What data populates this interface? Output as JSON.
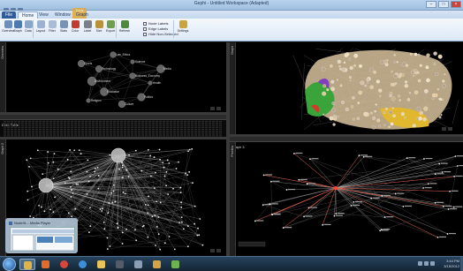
{
  "window": {
    "title": "Gephi - Untitled Workspace (Adapted)",
    "minimize_label": "–",
    "maximize_label": "□",
    "close_label": "×"
  },
  "ribbon_tabs": [
    {
      "label": "File"
    },
    {
      "label": "Home"
    },
    {
      "label": "View"
    },
    {
      "label": "Window"
    },
    {
      "label": "Graph"
    }
  ],
  "context_tab_label": "Tools",
  "ribbon": {
    "buttons": [
      {
        "label": "Overview",
        "icon": "overview-icon",
        "color": "#6a8fbf"
      },
      {
        "label": "Graph",
        "icon": "graph-icon",
        "color": "#4d79b0"
      },
      {
        "label": "Data",
        "icon": "data-icon",
        "color": "#8aa6c8"
      },
      {
        "label": "Layout",
        "icon": "layout-icon",
        "color": "#9cb2cf"
      },
      {
        "label": "Filter",
        "icon": "filter-icon",
        "color": "#a9bdd6"
      },
      {
        "label": "Stats",
        "icon": "stats-icon",
        "color": "#7993b5"
      },
      {
        "label": "Color",
        "icon": "color-icon",
        "color": "#c33a2e"
      },
      {
        "label": "Label",
        "icon": "label-icon",
        "color": "#7a7f8c"
      },
      {
        "label": "Size",
        "icon": "size-icon",
        "color": "#b8923a"
      },
      {
        "label": "Export",
        "icon": "export-icon",
        "color": "#6f9f4e"
      },
      {
        "label": "Refresh",
        "icon": "refresh-icon",
        "color": "#4c8a3e"
      },
      {
        "label": "Settings",
        "icon": "settings-icon",
        "color": "#c9a53c"
      }
    ],
    "checkboxes": [
      {
        "label": "Node Labels"
      },
      {
        "label": "Edge Labels"
      },
      {
        "label": "Hide Non-Selected"
      }
    ]
  },
  "panels": {
    "top_left": {
      "side_tab": "Overview",
      "nodes": [
        "Law_Ethics",
        "Science",
        "Technology",
        "Business_Economy",
        "Environment",
        "Health",
        "Education",
        "Politics",
        "Culture",
        "Religion",
        "Media",
        "Sports"
      ]
    },
    "top_right": {
      "side_tab": "Graph"
    },
    "middle_left": {
      "header": "Data Table"
    },
    "bottom_left": {
      "side_tab": "Graph 2"
    },
    "bottom_right": {
      "header": "Graph 3",
      "side_tab": "Preview"
    }
  },
  "thumbnail": {
    "title": "NodeXL - Media Player"
  },
  "taskbar": {
    "items": [
      {
        "icon": "explorer-icon",
        "color": "#e0b347"
      },
      {
        "icon": "media-player-icon",
        "color": "#e26b2a"
      },
      {
        "icon": "chrome-icon",
        "color": "#d9463a"
      },
      {
        "icon": "ie-icon",
        "color": "#3b8fd9"
      },
      {
        "icon": "folder-icon",
        "color": "#e7c35a"
      },
      {
        "icon": "terminal-icon",
        "color": "#555c66"
      },
      {
        "icon": "app-icon",
        "color": "#8a9db3"
      },
      {
        "icon": "paint-icon",
        "color": "#d6a343"
      },
      {
        "icon": "network-app-icon",
        "color": "#6cb24e"
      }
    ],
    "time": "3:44 PM",
    "date": "3/15/2012"
  }
}
